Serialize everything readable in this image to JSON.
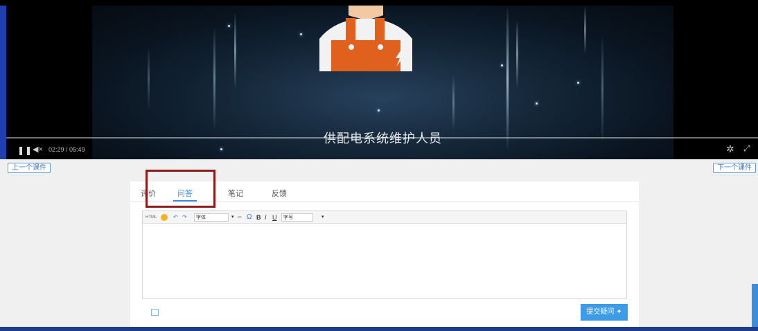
{
  "video": {
    "subtitle": "供配电系统维护人员",
    "current_time": "02:29",
    "duration": "05:49",
    "time_separator": " / ",
    "play_icon": "pause-icon",
    "volume_icon": "volume-icon",
    "settings_icon": "gear-icon",
    "fullscreen_icon": "fullscreen-icon",
    "mascot_colors": {
      "overalls": "#e0611e",
      "skin": "#f3c9a4",
      "shirt": "#f2f2f2"
    }
  },
  "course_nav": {
    "prev_label": "上一个课件",
    "next_label": "下一个课件"
  },
  "tabs": [
    {
      "label": "评价",
      "active": false
    },
    {
      "label": "问答",
      "active": true
    },
    {
      "label": "笔记",
      "active": false
    },
    {
      "label": "反馈",
      "active": false
    }
  ],
  "editor": {
    "toolbar": {
      "html_label": "HTML",
      "font_label": "字体",
      "bold_label": "B",
      "italic_label": "I",
      "underline_label": "U",
      "size_label": "字号",
      "omega_label": "Ω"
    },
    "content": ""
  },
  "submit": {
    "label": "提交疑问"
  },
  "colors": {
    "accent": "#3a8ee6",
    "highlight_box": "#8b1a1a",
    "submit_bg": "#3c9ce8"
  }
}
